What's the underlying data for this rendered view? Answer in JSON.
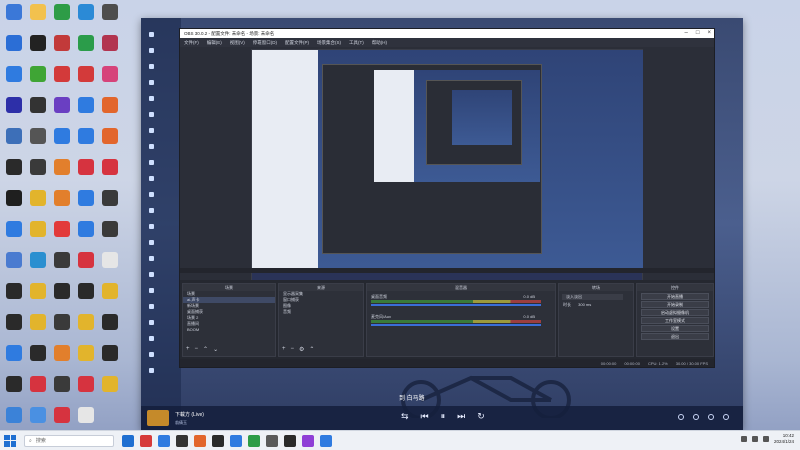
{
  "desktop": {
    "icons": [
      {
        "label": "",
        "color": "#3b78d8"
      },
      {
        "label": "",
        "color": "#f2c14e"
      },
      {
        "label": "",
        "color": "#2d9c47"
      },
      {
        "label": "",
        "color": "#2b8ad6"
      },
      {
        "label": "",
        "color": "#4d4d4d"
      },
      {
        "label": "",
        "color": "#2b6ed6"
      },
      {
        "label": "",
        "color": "#222222"
      },
      {
        "label": "",
        "color": "#c23a3a"
      },
      {
        "label": "",
        "color": "#2b9c4a"
      },
      {
        "label": "",
        "color": "#b2344f"
      },
      {
        "label": "",
        "color": "#2f7be0"
      },
      {
        "label": "",
        "color": "#3fa535"
      },
      {
        "label": "",
        "color": "#d33a3a"
      },
      {
        "label": "",
        "color": "#d33a3a"
      },
      {
        "label": "",
        "color": "#d6437a"
      },
      {
        "label": "",
        "color": "#2d2fa8"
      },
      {
        "label": "",
        "color": "#333333"
      },
      {
        "label": "",
        "color": "#6a3fc2"
      },
      {
        "label": "",
        "color": "#2f7be0"
      },
      {
        "label": "",
        "color": "#e2662c"
      },
      {
        "label": "",
        "color": "#3d6fb8"
      },
      {
        "label": "",
        "color": "#555555"
      },
      {
        "label": "",
        "color": "#2f7be0"
      },
      {
        "label": "",
        "color": "#2f7be0"
      },
      {
        "label": "",
        "color": "#e2662c"
      },
      {
        "label": "",
        "color": "#2a2a2a"
      },
      {
        "label": "",
        "color": "#3a3a3a"
      },
      {
        "label": "",
        "color": "#e27f2c"
      },
      {
        "label": "",
        "color": "#d6333f"
      },
      {
        "label": "",
        "color": "#d6333f"
      },
      {
        "label": "",
        "color": "#1f1f1f"
      },
      {
        "label": "",
        "color": "#e2b42c"
      },
      {
        "label": "",
        "color": "#e27f2c"
      },
      {
        "label": "",
        "color": "#2f7be0"
      },
      {
        "label": "",
        "color": "#3a3a3a"
      },
      {
        "label": "",
        "color": "#2f7be0"
      },
      {
        "label": "",
        "color": "#e2b42c"
      },
      {
        "label": "",
        "color": "#e23a3a"
      },
      {
        "label": "",
        "color": "#2f7be0"
      },
      {
        "label": "",
        "color": "#3a3a3a"
      },
      {
        "label": "",
        "color": "#4a7bd0"
      },
      {
        "label": "",
        "color": "#2a8fd0"
      },
      {
        "label": "",
        "color": "#3a3a3a"
      },
      {
        "label": "",
        "color": "#d6333f"
      },
      {
        "label": "",
        "color": "#e6e6e6"
      },
      {
        "label": "",
        "color": "#2a2a2a"
      },
      {
        "label": "",
        "color": "#e2b42c"
      },
      {
        "label": "",
        "color": "#2a2a2a"
      },
      {
        "label": "",
        "color": "#2a2a2a"
      },
      {
        "label": "",
        "color": "#e2b42c"
      },
      {
        "label": "",
        "color": "#2a2a2a"
      },
      {
        "label": "",
        "color": "#e2b42c"
      },
      {
        "label": "",
        "color": "#3a3a3a"
      },
      {
        "label": "",
        "color": "#e2b42c"
      },
      {
        "label": "",
        "color": "#2a2a2a"
      },
      {
        "label": "",
        "color": "#2f7be0"
      },
      {
        "label": "",
        "color": "#2a2a2a"
      },
      {
        "label": "",
        "color": "#e27f2c"
      },
      {
        "label": "",
        "color": "#e2b42c"
      },
      {
        "label": "",
        "color": "#2a2a2a"
      },
      {
        "label": "",
        "color": "#2a2a2a"
      },
      {
        "label": "",
        "color": "#d6333f"
      },
      {
        "label": "",
        "color": "#3a3a3a"
      },
      {
        "label": "",
        "color": "#d6333f"
      },
      {
        "label": "",
        "color": "#e2b42c"
      },
      {
        "label": "",
        "color": "#3b82d8"
      },
      {
        "label": "",
        "color": "#4a90e2"
      },
      {
        "label": "",
        "color": "#d6333f"
      },
      {
        "label": "",
        "color": "#e6e6e6"
      }
    ]
  },
  "music": {
    "sidebar_items": [
      "",
      "",
      "",
      "",
      "",
      "",
      "",
      "",
      "",
      "",
      "",
      "",
      "",
      "",
      "",
      "",
      "",
      "",
      "",
      "",
      "",
      ""
    ],
    "song_title": "下載方 (Live)",
    "song_artist": "翁倩玉",
    "lyric": "到 白马路",
    "controls": {
      "shuffle": "⇆",
      "prev": "⏮",
      "play": "⏸",
      "next": "⏭",
      "loop": "↻"
    }
  },
  "obs": {
    "title": "OBS 30.0.2 - 配置文件: 未命名 - 场景: 未命名",
    "menus": [
      "文件(F)",
      "编辑(E)",
      "视图(V)",
      "停靠窗口(D)",
      "配置文件(P)",
      "场景集合(S)",
      "工具(T)",
      "帮助(H)"
    ],
    "docks": {
      "scenes_title": "场景",
      "sources_title": "来源",
      "mixer_title": "混音器",
      "transitions_title": "转场",
      "controls_title": "控件",
      "scenes": [
        "场景",
        "ai-声卡",
        "新场景",
        "桌面捕获",
        "场景 2",
        "直播间",
        "BOOM"
      ],
      "sources": [
        "显示器采集",
        "窗口捕获",
        "图像",
        "音频"
      ],
      "mixer": [
        {
          "name": "桌面音频",
          "value": "0.0 dB"
        },
        {
          "name": "麦克风/Aux",
          "value": "0.0 dB"
        }
      ],
      "transition": {
        "type": "淡入淡出",
        "duration_label": "时长",
        "duration": "300 ms"
      },
      "controls": [
        "开始直播",
        "开始录制",
        "启动虚拟摄像机",
        "工作室模式",
        "设置",
        "退出"
      ]
    },
    "footer": {
      "cpu": "CPU: 1.2%",
      "fps": "30.00 / 30.00 FPS",
      "time1": "00:00:00",
      "time2": "00:00:00"
    }
  },
  "taskbar": {
    "search_placeholder": "搜索",
    "clock_time": "10:42",
    "clock_date": "2024/1/24",
    "apps": [
      "#1f6fd1",
      "#d63a3a",
      "#2f7be0",
      "#333333",
      "#e2662c",
      "#2a2a2a",
      "#2f7be0",
      "#2d9c47",
      "#5a5a5a",
      "#2a2a2a",
      "#8f3fd6",
      "#2f7be0"
    ]
  }
}
